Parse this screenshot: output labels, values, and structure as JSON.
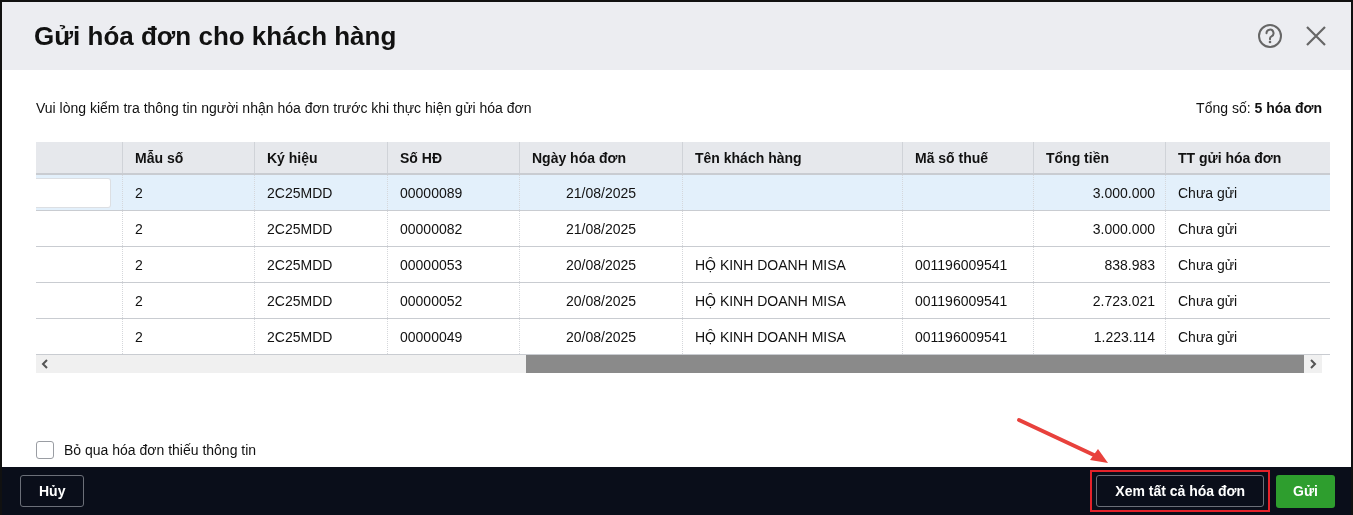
{
  "window": {
    "title": "Gửi hóa đơn cho khách hàng"
  },
  "notice": "Vui lòng kiểm tra thông tin người nhận hóa đơn trước khi thực hiện gửi hóa đơn",
  "total": "Tổng số: **5 hóa đơn**",
  "table": {
    "columns": [
      "Mẫu số",
      "Ký hiệu",
      "Số HĐ",
      "Ngày hóa đơn",
      "Tên khách hàng",
      "Mã số thuế",
      "Tổng tiền",
      "TT gửi hóa đơn"
    ],
    "rows": [
      {
        "selected": true,
        "cells": [
          "2",
          "2C25MDD",
          "00000089",
          "21/08/2025",
          "",
          "",
          "3.000.000",
          "Chưa gửi"
        ]
      },
      {
        "selected": false,
        "cells": [
          "2",
          "2C25MDD",
          "00000082",
          "21/08/2025",
          "",
          "",
          "3.000.000",
          "Chưa gửi"
        ]
      },
      {
        "selected": false,
        "cells": [
          "2",
          "2C25MDD",
          "00000053",
          "20/08/2025",
          "HỘ KINH DOANH MISA",
          "001196009541",
          "838.983",
          "Chưa gửi"
        ]
      },
      {
        "selected": false,
        "cells": [
          "2",
          "2C25MDD",
          "00000052",
          "20/08/2025",
          "HỘ KINH DOANH MISA",
          "001196009541",
          "2.723.021",
          "Chưa gửi"
        ]
      },
      {
        "selected": false,
        "cells": [
          "2",
          "2C25MDD",
          "00000049",
          "20/08/2025",
          "HỘ KINH DOANH MISA",
          "001196009541",
          "1.223.114",
          "Chưa gửi"
        ]
      }
    ]
  },
  "skip_incomplete": {
    "label": "Bỏ qua hóa đơn thiếu thông tin",
    "checked": false
  },
  "buttons": {
    "cancel": "Hủy",
    "view_all": "Xem tất cả hóa đơn",
    "send": "Gửi"
  }
}
